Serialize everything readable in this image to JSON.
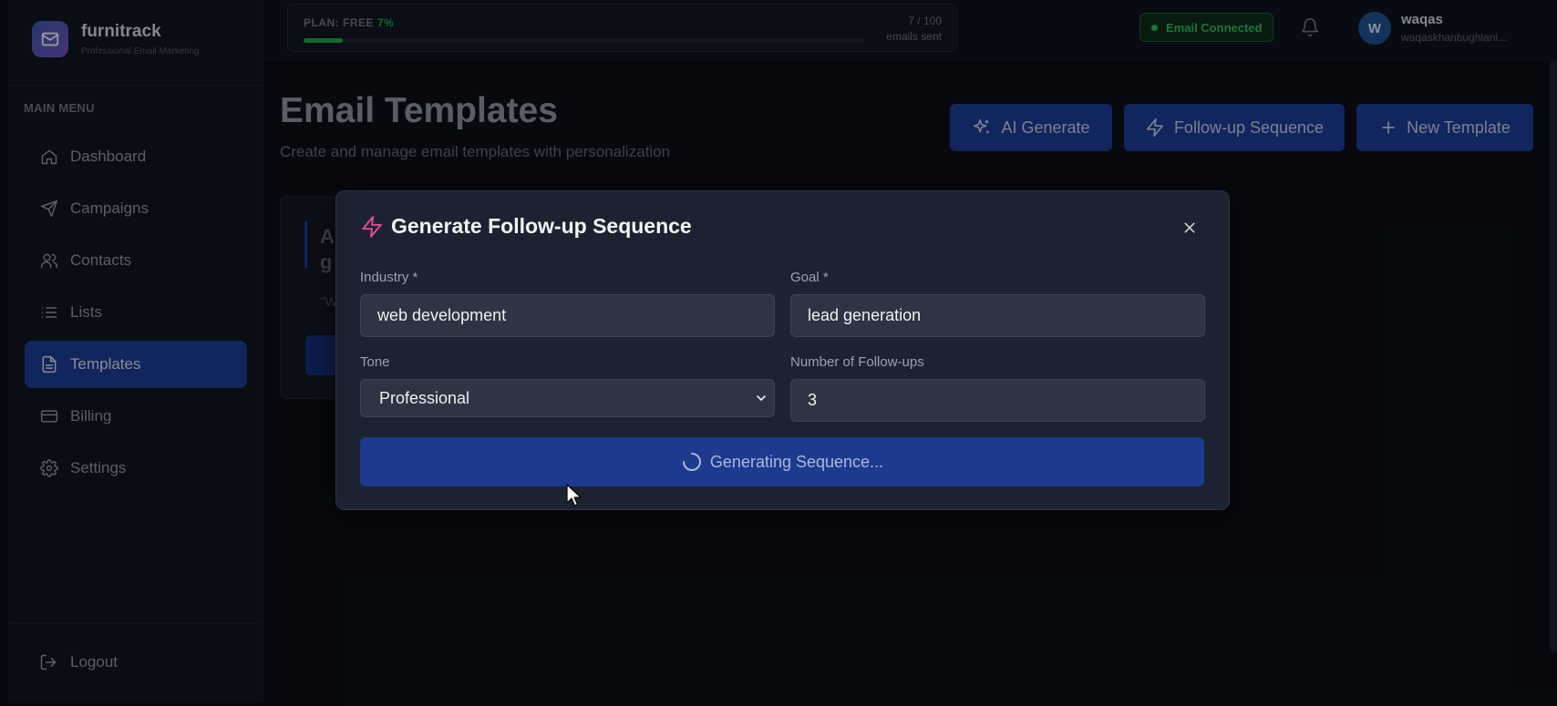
{
  "brand": {
    "name": "furnitrack",
    "subtitle": "Professional Email Marketing"
  },
  "sidebar": {
    "heading": "MAIN MENU",
    "items": [
      {
        "label": "Dashboard",
        "icon": "home-icon"
      },
      {
        "label": "Campaigns",
        "icon": "send-icon"
      },
      {
        "label": "Contacts",
        "icon": "users-icon"
      },
      {
        "label": "Lists",
        "icon": "list-icon"
      },
      {
        "label": "Templates",
        "icon": "file-text-icon",
        "active": true
      },
      {
        "label": "Billing",
        "icon": "credit-card-icon"
      },
      {
        "label": "Settings",
        "icon": "gear-icon"
      }
    ],
    "logout_label": "Logout"
  },
  "topbar": {
    "plan_label": "PLAN: FREE",
    "plan_percent_text": "7%",
    "plan_progress": 0.07,
    "usage_count": "7 / 100",
    "usage_unit": "emails sent",
    "email_status": "Email Connected",
    "user_initial": "W",
    "user_name": "waqas",
    "user_email": "waqaskhanbughlani..."
  },
  "main": {
    "title": "Email Templates",
    "subtitle": "Create and manage email templates with personalization",
    "buttons": {
      "ai_generate": "AI Generate",
      "followup": "Follow-up Sequence",
      "new_template": "New Template"
    },
    "card": {
      "title_line1": "A",
      "title_line2": "g",
      "preview": "\"W"
    }
  },
  "modal": {
    "title": "Generate Follow-up Sequence",
    "industry_label": "Industry *",
    "industry_value": "web development",
    "goal_label": "Goal *",
    "goal_value": "lead generation",
    "tone_label": "Tone",
    "tone_value": "Professional",
    "followups_label": "Number of Follow-ups",
    "followups_value": "3",
    "generate_label": "Generating Sequence..."
  },
  "colors": {
    "accent": "#1d3a8f",
    "success": "#2fb45a",
    "modal_icon": "#e0508f"
  }
}
